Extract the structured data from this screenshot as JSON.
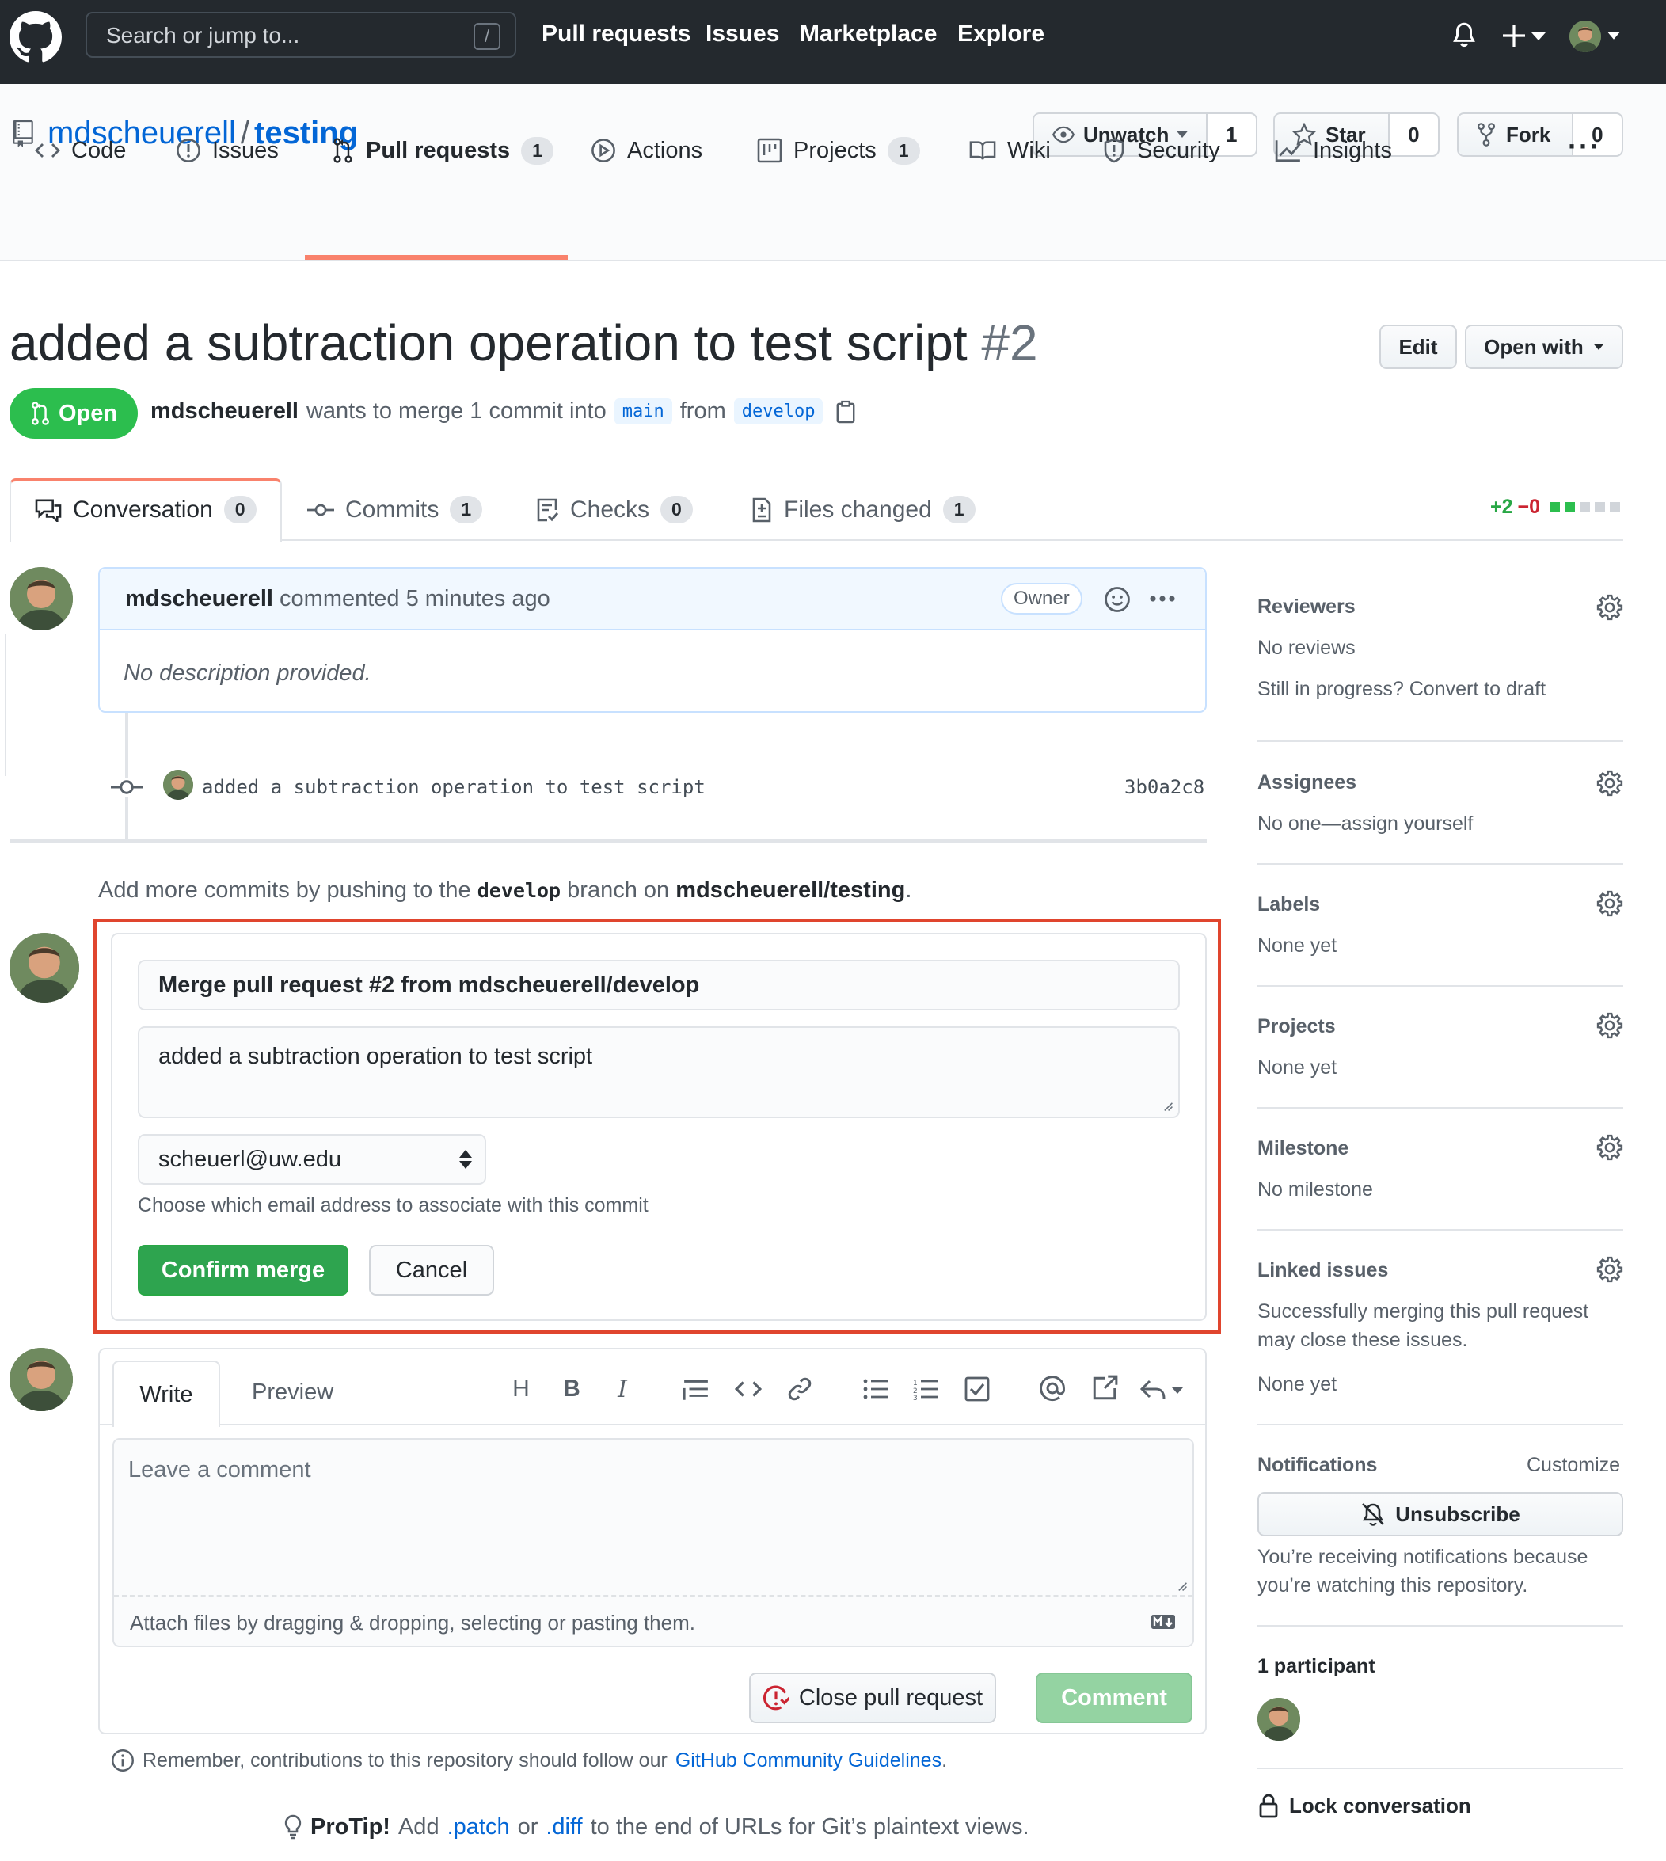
{
  "header": {
    "search_placeholder": "Search or jump to...",
    "search_shortcut": "/",
    "nav": [
      "Pull requests",
      "Issues",
      "Marketplace",
      "Explore"
    ]
  },
  "repo": {
    "owner": "mdscheuerell",
    "separator": "/",
    "name": "testing",
    "watch_label": "Unwatch",
    "watch_count": "1",
    "star_label": "Star",
    "star_count": "0",
    "fork_label": "Fork",
    "fork_count": "0",
    "tabs": [
      {
        "label": "Code",
        "count": ""
      },
      {
        "label": "Issues",
        "count": ""
      },
      {
        "label": "Pull requests",
        "count": "1"
      },
      {
        "label": "Actions",
        "count": ""
      },
      {
        "label": "Projects",
        "count": "1"
      },
      {
        "label": "Wiki",
        "count": ""
      },
      {
        "label": "Security",
        "count": ""
      },
      {
        "label": "Insights",
        "count": ""
      }
    ],
    "more": "···"
  },
  "pr": {
    "title": "added a subtraction operation to test script",
    "number": "#2",
    "edit_label": "Edit",
    "open_with_label": "Open with",
    "state": "Open",
    "author": "mdscheuerell",
    "merge_text": "wants to merge 1 commit into",
    "base_branch": "main",
    "from_text": "from",
    "head_branch": "develop",
    "tabs": [
      {
        "label": "Conversation",
        "count": "0"
      },
      {
        "label": "Commits",
        "count": "1"
      },
      {
        "label": "Checks",
        "count": "0"
      },
      {
        "label": "Files changed",
        "count": "1"
      }
    ],
    "additions": "+2",
    "deletions": "−0",
    "colors": {
      "open": "#2cbe4e",
      "accent": "#f9826c",
      "link": "#0366d6",
      "add": "#28a745",
      "del": "#cb2431"
    }
  },
  "comment": {
    "author": "mdscheuerell",
    "meta": "commented 5 minutes ago",
    "role": "Owner",
    "body": "No description provided."
  },
  "commit": {
    "message": "added a subtraction operation to test script",
    "sha": "3b0a2c8"
  },
  "push_note": {
    "prefix": "Add more commits by pushing to the",
    "branch": "develop",
    "middle": "branch on",
    "repo": "mdscheuerell/testing",
    "suffix": "."
  },
  "merge_form": {
    "title_value": "Merge pull request #2 from mdscheuerell/develop",
    "message_value": "added a subtraction operation to test script",
    "email_value": "scheuerl@uw.edu",
    "email_hint": "Choose which email address to associate with this commit",
    "confirm_label": "Confirm merge",
    "cancel_label": "Cancel"
  },
  "composer": {
    "write_tab": "Write",
    "preview_tab": "Preview",
    "placeholder": "Leave a comment",
    "attach_text": "Attach files by dragging & dropping, selecting or pasting them.",
    "close_label": "Close pull request",
    "comment_label": "Comment"
  },
  "footer": {
    "remember_prefix": "Remember, contributions to this repository should follow our",
    "remember_link": "GitHub Community Guidelines",
    "remember_suffix": ".",
    "protip_label": "ProTip!",
    "protip_a": "Add",
    "protip_patch": ".patch",
    "protip_or": "or",
    "protip_diff": ".diff",
    "protip_rest": "to the end of URLs for Git’s plaintext views."
  },
  "sidebar": {
    "reviewers_h": "Reviewers",
    "reviewers_1": "No reviews",
    "reviewers_2": "Still in progress? Convert to draft",
    "assignees_h": "Assignees",
    "assignees_t": "No one—assign yourself",
    "labels_h": "Labels",
    "labels_t": "None yet",
    "projects_h": "Projects",
    "projects_t": "None yet",
    "milestone_h": "Milestone",
    "milestone_t": "No milestone",
    "linked_h": "Linked issues",
    "linked_1": "Successfully merging this pull request",
    "linked_2": "may close these issues.",
    "linked_3": "None yet",
    "notif_h": "Notifications",
    "notif_customize": "Customize",
    "unsubscribe_label": "Unsubscribe",
    "notif_1": "You’re receiving notifications because",
    "notif_2": "you’re watching this repository.",
    "participants_h": "1 participant",
    "lock_label": "Lock conversation"
  }
}
